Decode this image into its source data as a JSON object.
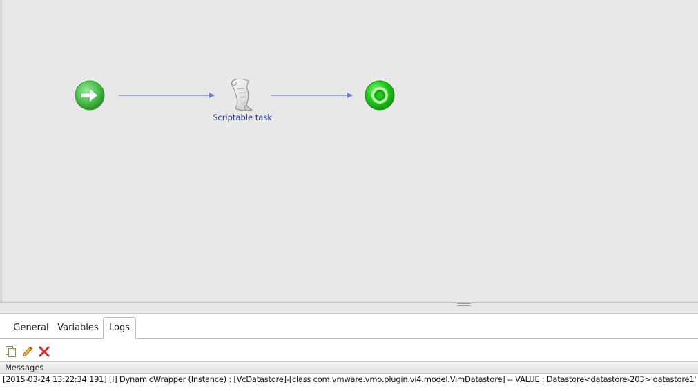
{
  "workflow": {
    "start_icon": "start-arrow-icon",
    "task_icon": "scroll-icon",
    "task_label": "Scriptable task",
    "end_icon": "end-target-icon"
  },
  "tabs": [
    {
      "label": "General",
      "active": false
    },
    {
      "label": "Variables",
      "active": false
    },
    {
      "label": "Logs",
      "active": true
    }
  ],
  "toolbar": {
    "copy_icon": "copy-icon",
    "edit_icon": "pencil-icon",
    "clear_icon": "delete-icon"
  },
  "messages": {
    "header": "Messages",
    "lines": [
      "[2015-03-24 13:22:34.191] [I] DynamicWrapper (Instance) : [VcDatastore]-[class com.vmware.vmo.plugin.vi4.model.VimDatastore] -- VALUE : Datastore<datastore-203>'datastore1'"
    ]
  },
  "colors": {
    "canvas_bg": "#e8e8e8",
    "connector": "#6b7fd6",
    "task_label": "#1f3b8c",
    "start_green": "#4cc04c",
    "end_green": "#22c81e"
  }
}
